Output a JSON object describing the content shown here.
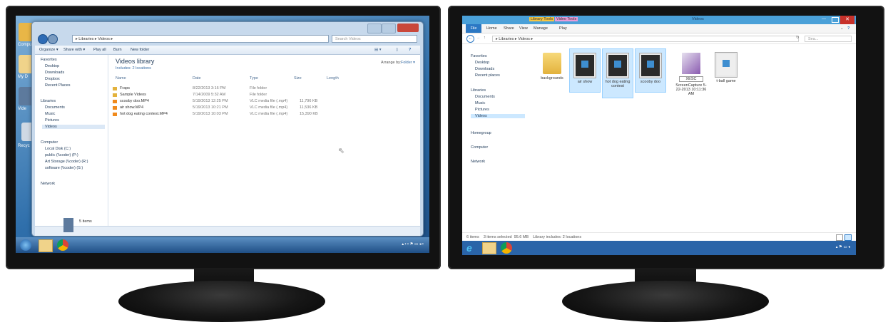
{
  "left_screen": {
    "desktop_icons": [
      "Compu",
      "My D",
      "Vide",
      "Recyc"
    ],
    "explorer": {
      "address": "▸ Libraries ▸ Videos ▸",
      "search_placeholder": "Search Videos",
      "toolbar": [
        "Organize ▾",
        "Share with ▾",
        "Play all",
        "Burn",
        "New folder"
      ],
      "nav": {
        "favorites": "Favorites",
        "fav_items": [
          "Desktop",
          "Downloads",
          "Dropbox",
          "Recent Places"
        ],
        "libraries": "Libraries",
        "lib_items": [
          "Documents",
          "Music",
          "Pictures",
          "Videos"
        ],
        "computer": "Computer",
        "comp_items": [
          "Local Disk (C:)",
          "public (\\\\coder) (P:)",
          "Art Storage (\\\\coder) (R:)",
          "software (\\\\coder) (S:)"
        ],
        "network": "Network"
      },
      "library_title": "Videos library",
      "library_subtitle": "Includes: 2 locations",
      "arrange_label": "Arrange by:",
      "arrange_value": "Folder ▾",
      "columns": [
        "Name",
        "Date",
        "Type",
        "Size",
        "Length"
      ],
      "rows": [
        {
          "name": "Fraps",
          "date": "8/22/2013 3:16 PM",
          "type": "File folder",
          "size": ""
        },
        {
          "name": "Sample Videos",
          "date": "7/14/2009 5:32 AM",
          "type": "File folder",
          "size": ""
        },
        {
          "name": "scooby doo.MP4",
          "date": "5/19/2013 12:25 PM",
          "type": "VLC media file (.mp4)",
          "size": "11,796 KB"
        },
        {
          "name": "air show.MP4",
          "date": "5/19/2013 10:21 PM",
          "type": "VLC media file (.mp4)",
          "size": "11,536 KB"
        },
        {
          "name": "hot dog eating contest.MP4",
          "date": "5/19/2013 10:03 PM",
          "type": "VLC media file (.mp4)",
          "size": "15,390 KB"
        }
      ],
      "status": "5 items"
    }
  },
  "right_screen": {
    "explorer": {
      "context_tabs": [
        "Library Tools",
        "Video Tools"
      ],
      "title": "Videos",
      "ribbon_tabs": [
        "File",
        "Home",
        "Share",
        "View",
        "Manage",
        "Play"
      ],
      "address": "▸ Libraries ▸ Videos ▸",
      "search_placeholder": "Sea...",
      "nav": {
        "favorites": "Favorites",
        "fav_items": [
          "Desktop",
          "Downloads",
          "Recent places"
        ],
        "libraries": "Libraries",
        "lib_items": [
          "Documents",
          "Music",
          "Pictures",
          "Videos"
        ],
        "homegroup": "Homegroup",
        "computer": "Computer",
        "network": "Network"
      },
      "items": [
        {
          "name": "backgrounds",
          "kind": "folder",
          "selected": false
        },
        {
          "name": "air show",
          "kind": "video",
          "selected": true
        },
        {
          "name": "hot dog eating contest",
          "kind": "video",
          "selected": true
        },
        {
          "name": "scooby doo",
          "kind": "video",
          "selected": true
        },
        {
          "name": "ScreenCapture 5-22-2013 10:11:36 AM",
          "kind": "xesc",
          "badge": "XESC",
          "selected": false
        },
        {
          "name": "t-ball game",
          "kind": "video-light",
          "selected": false
        }
      ],
      "status": "6 items    3 items selected  95.6 MB    Library includes: 2 locations"
    }
  }
}
